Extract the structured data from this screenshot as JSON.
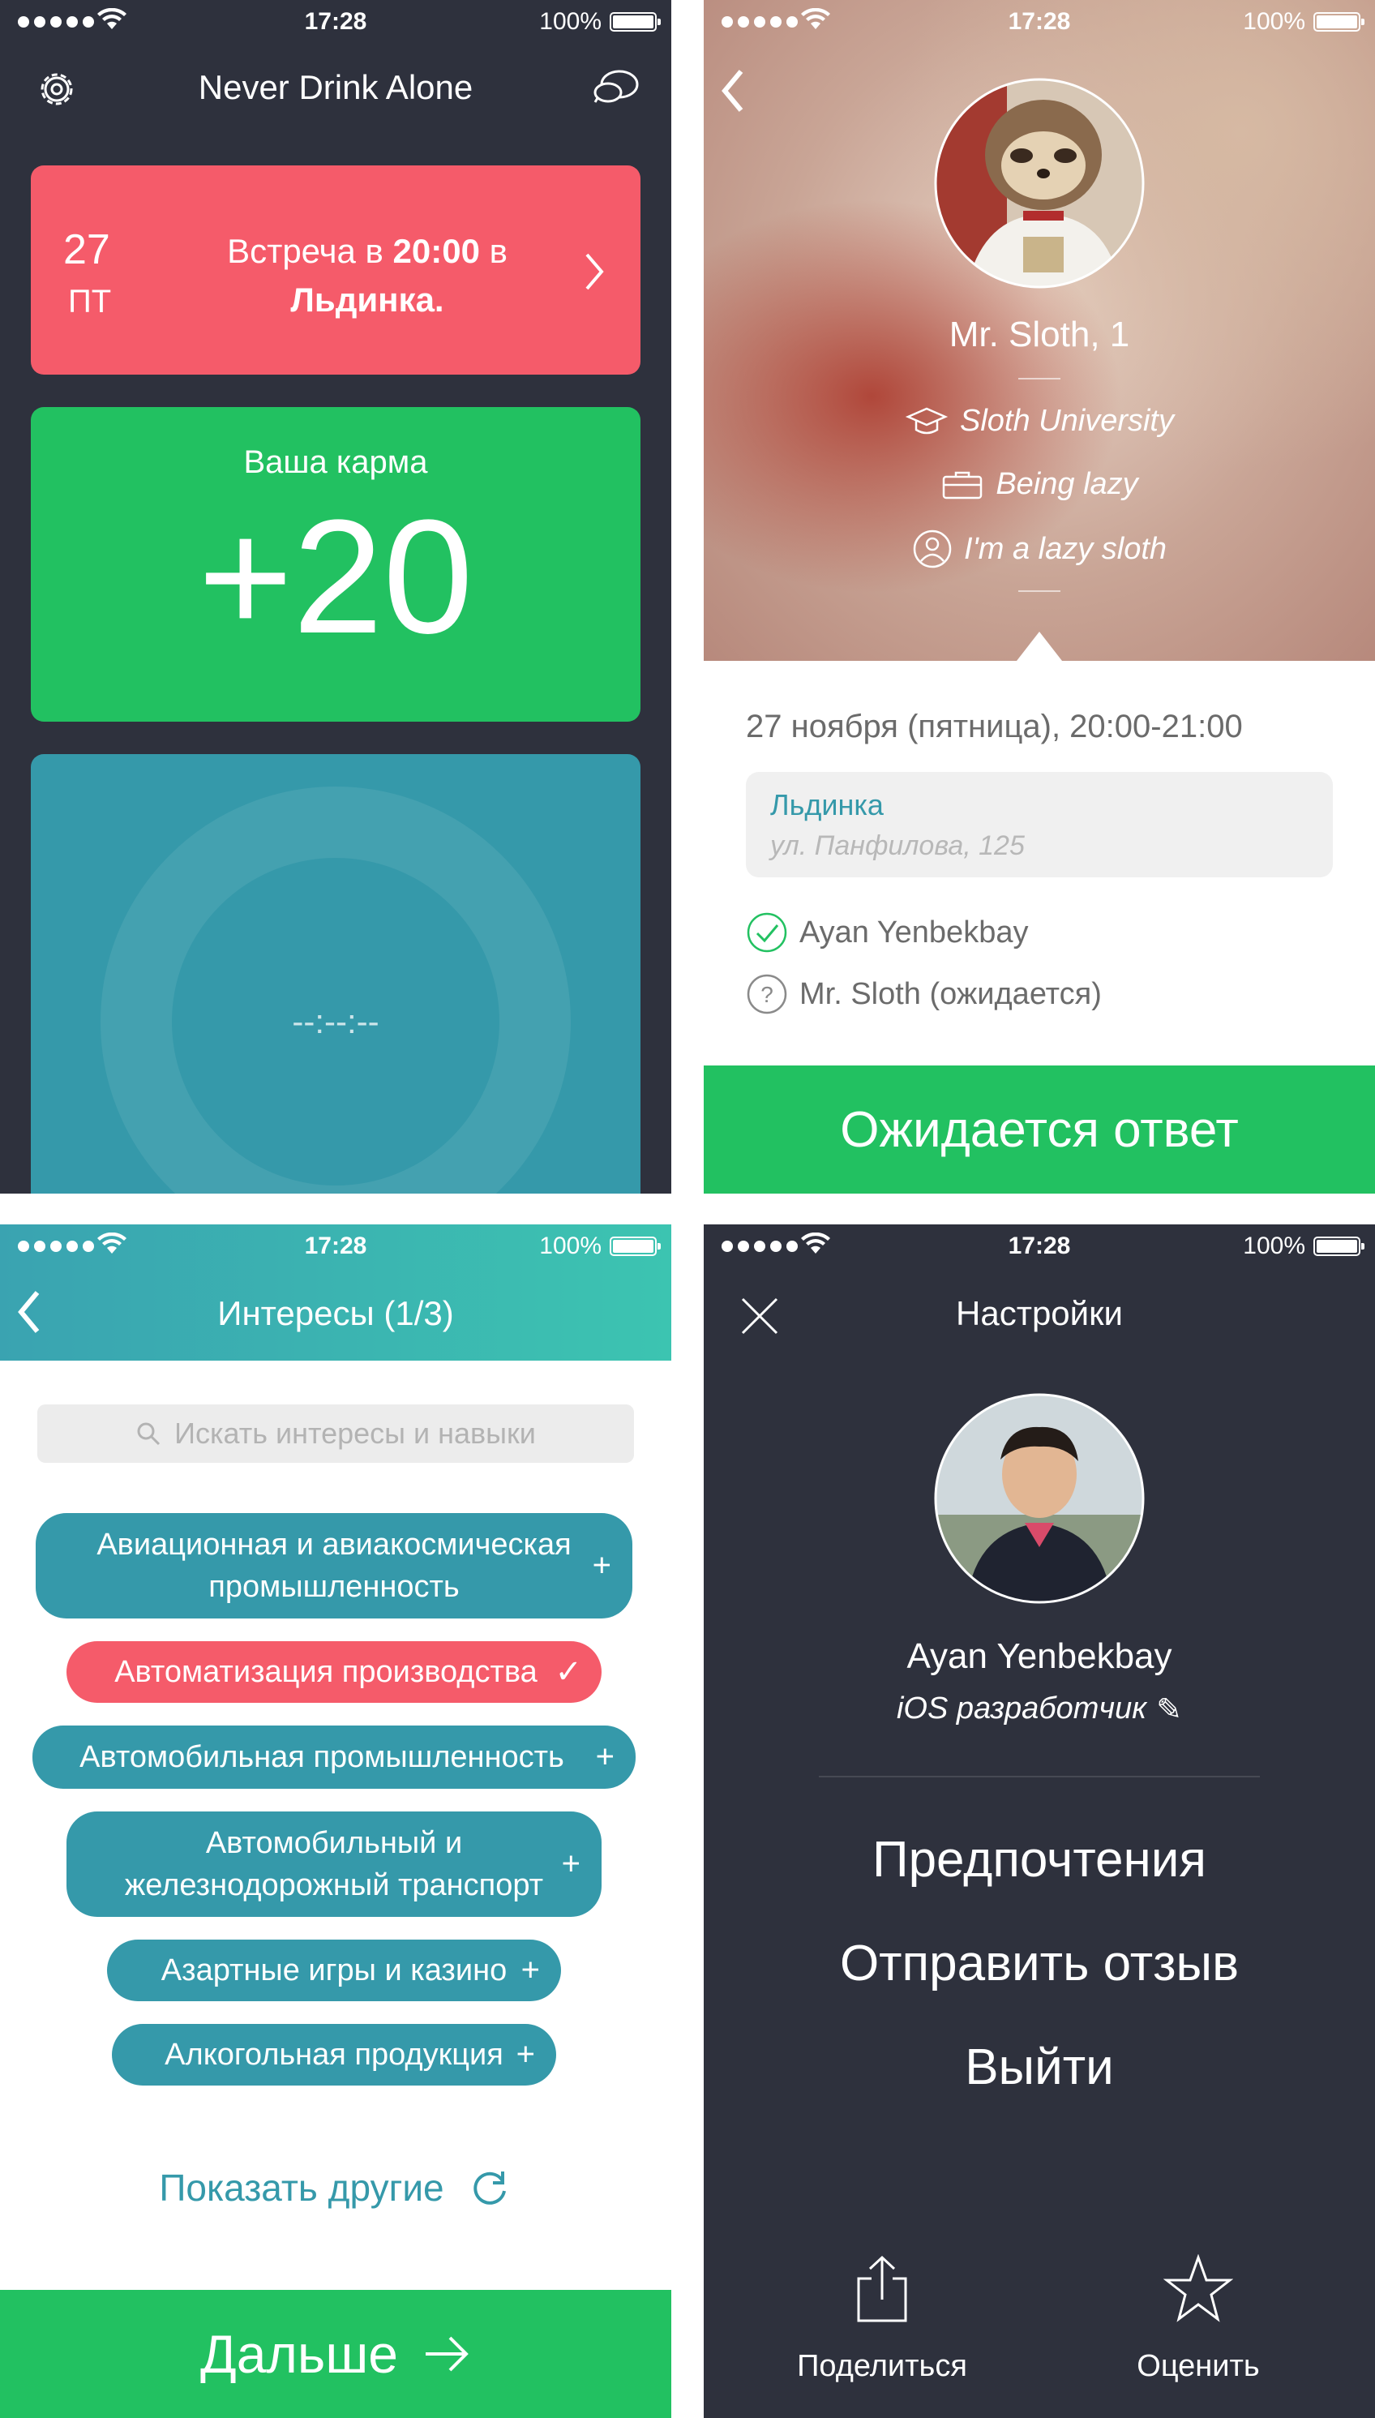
{
  "status_bar": {
    "time": "17:28",
    "battery": "100%"
  },
  "screen1": {
    "title": "Never Drink Alone",
    "meeting": {
      "day": "27",
      "weekday": "ПТ",
      "line1_prefix": "Встреча в ",
      "line1_time": "20:00",
      "line1_suffix": " в",
      "line2": "Льдинка."
    },
    "karma": {
      "label": "Ваша карма",
      "value": "+20"
    },
    "timer": {
      "value": "--:--:--"
    }
  },
  "screen2": {
    "name": "Mr. Sloth, 1",
    "university": "Sloth University",
    "job": "Being lazy",
    "about": "I'm a lazy sloth",
    "datetime": "27 ноября (пятница), 20:00-21:00",
    "place": {
      "name": "Льдинка",
      "address": "ул. Панфилова, 125"
    },
    "participants": [
      {
        "name": "Ayan Yenbekbay",
        "status": "confirmed"
      },
      {
        "name": "Mr. Sloth (ожидается)",
        "status": "pending"
      }
    ],
    "action_label": "Ожидается ответ"
  },
  "screen3": {
    "title": "Интересы (1/3)",
    "search_placeholder": "Искать интересы и навыки",
    "tags": [
      {
        "label": "Авиационная и авиакосмическая промышленность",
        "selected": false
      },
      {
        "label": "Автоматизация производства",
        "selected": true
      },
      {
        "label": "Автомобильная промышленность",
        "selected": false
      },
      {
        "label": "Автомобильный и железнодорожный транспорт",
        "selected": false
      },
      {
        "label": "Азартные игры и казино",
        "selected": false
      },
      {
        "label": "Алкогольная продукция",
        "selected": false
      }
    ],
    "show_more": "Показать другие",
    "next_label": "Дальше"
  },
  "screen4": {
    "title": "Настройки",
    "name": "Ayan Yenbekbay",
    "role": "iOS разработчик",
    "menu": [
      "Предпочтения",
      "Отправить отзыв",
      "Выйти"
    ],
    "share_label": "Поделиться",
    "rate_label": "Оценить"
  },
  "colors": {
    "dark": "#2e313d",
    "green": "#22c161",
    "red": "#f55b6a",
    "teal": "#3599aa"
  }
}
